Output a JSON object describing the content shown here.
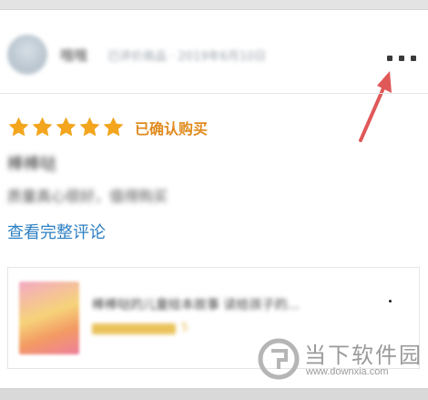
{
  "review": {
    "username": "哦哦",
    "header_meta": "已评价商品 · 2019年6月10日",
    "star_count": 5,
    "confirmed_label": "已确认购买",
    "title": "棒棒哒",
    "body": "质量真心很好，值得购买",
    "full_review_link": "查看完整评论"
  },
  "product": {
    "name": "棒棒哒的儿童绘本故事 读给孩子的...",
    "rating_text": "5"
  },
  "watermark": {
    "text": "当下软件园",
    "url": "www.downxia.com"
  },
  "colors": {
    "star": "#f2a51d",
    "confirmed": "#e08a1e",
    "link": "#2d7fc2",
    "annotation_arrow": "#e05858"
  },
  "icons": {
    "more": "more-dots-icon",
    "star": "star-icon",
    "annotation": "red-arrow"
  }
}
